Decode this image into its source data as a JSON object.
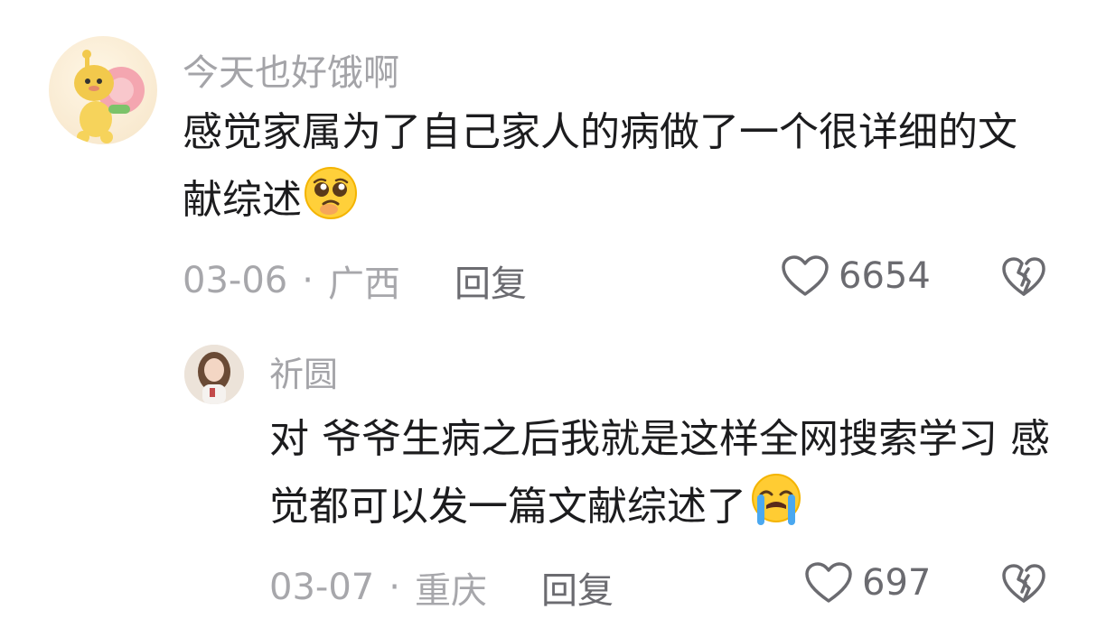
{
  "comments": [
    {
      "author": "今天也好饿啊",
      "text": "感觉家属为了自己家人的病做了一个很详细的文献综述",
      "emoji": "pleading-face",
      "date": "03-06",
      "location": "广西",
      "reply_label": "回复",
      "likes": "6654"
    },
    {
      "author": "祈圆",
      "text": "对 爷爷生病之后我就是这样全网搜索学习 感觉都可以发一篇文献综述了",
      "emoji": "loudly-crying-face",
      "date": "03-07",
      "location": "重庆",
      "reply_label": "回复",
      "likes": "697"
    }
  ],
  "separator": "·",
  "colors": {
    "text": "#1c1c1e",
    "muted": "#a7a7ab",
    "icon": "#6b6b70",
    "background": "#ffffff"
  }
}
